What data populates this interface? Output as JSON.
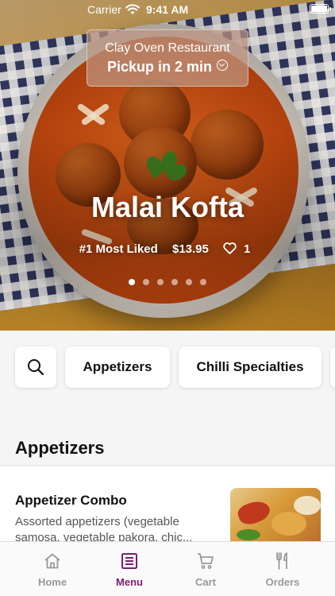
{
  "status_bar": {
    "carrier": "Carrier",
    "time": "9:41 AM"
  },
  "restaurant": {
    "name": "Clay Oven Restaurant",
    "pickup": "Pickup in 2 min"
  },
  "featured": {
    "title": "Malai Kofta",
    "badge": "#1 Most Liked",
    "price": "$13.95",
    "likes": "1",
    "page_count": 6,
    "active_page": 0
  },
  "categories": [
    {
      "icon": "search-icon"
    },
    {
      "label": "Appetizers"
    },
    {
      "label": "Chilli Specialties"
    }
  ],
  "section": {
    "title": "Appetizers"
  },
  "items": [
    {
      "name": "Appetizer Combo",
      "description": "Assorted appetizers (vegetable samosa, vegetable pakora, chic..."
    }
  ],
  "tabs": [
    {
      "label": "Home",
      "icon": "home-icon",
      "active": false
    },
    {
      "label": "Menu",
      "icon": "menu-icon",
      "active": true
    },
    {
      "label": "Cart",
      "icon": "cart-icon",
      "active": false
    },
    {
      "label": "Orders",
      "icon": "fork-knife-icon",
      "active": false
    }
  ],
  "colors": {
    "accent": "#7b1f73",
    "inactive_tab": "#999999",
    "background": "#f5f5f5"
  }
}
